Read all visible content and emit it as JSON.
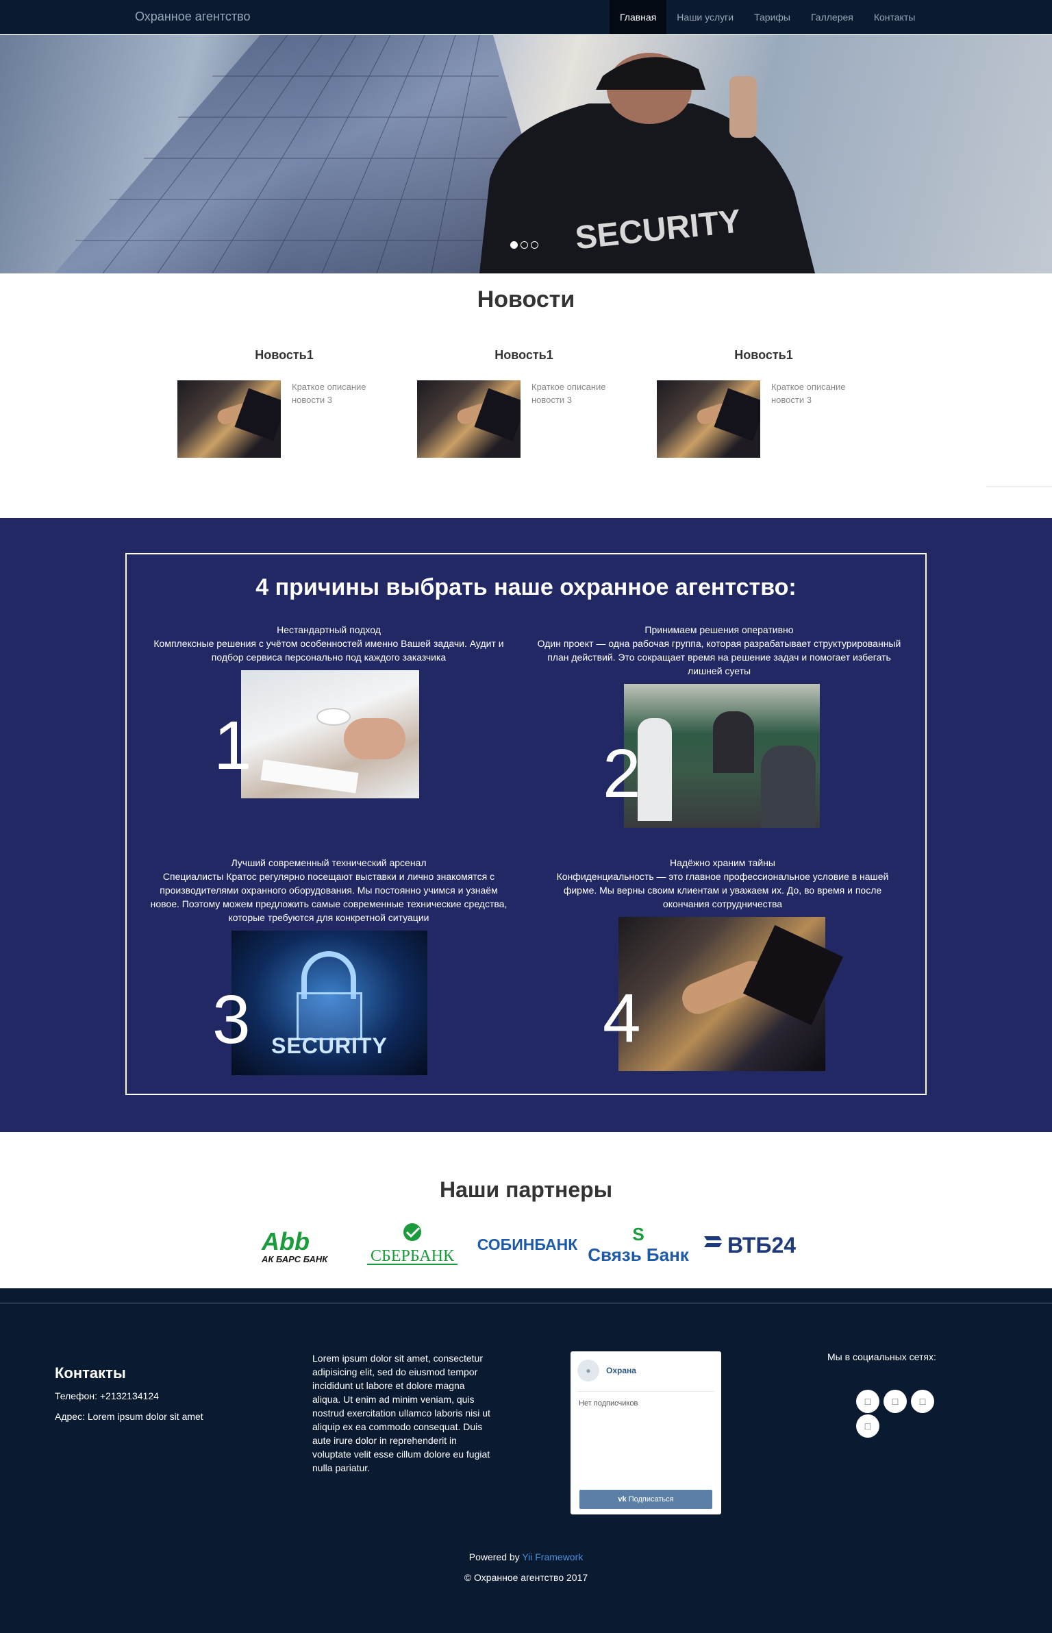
{
  "navbar": {
    "brand": "Охранное агентство",
    "items": [
      {
        "label": "Главная",
        "active": true
      },
      {
        "label": "Наши услуги"
      },
      {
        "label": "Тарифы"
      },
      {
        "label": "Галлерея"
      },
      {
        "label": "Контакты"
      }
    ]
  },
  "hero": {
    "caption": "SECURITY",
    "slides": 3,
    "active_slide": 1
  },
  "news": {
    "title": "Новости",
    "items": [
      {
        "title": "Новость1",
        "text": "Краткое описание новости 3"
      },
      {
        "title": "Новость1",
        "text": "Краткое описание новости 3"
      },
      {
        "title": "Новость1",
        "text": "Краткое описание новости 3"
      }
    ]
  },
  "reasons": {
    "title": "4 причины выбрать наше охранное агентство:",
    "items": [
      {
        "num": "1",
        "title": "Нестандартный подход",
        "text": "Комплексные решения с учётом особенностей именно Вашей задачи. Аудит и подбор сервиса персонально под каждого заказчика"
      },
      {
        "num": "2",
        "title": "Принимаем решения оперативно",
        "text": "Один проект — одна рабочая группа, которая разрабатывает структурированный план действий. Это сокращает время на решение задач и помогает избегать лишней суеты"
      },
      {
        "num": "3",
        "title": "Лучший современный технический арсенал",
        "text": "Специалисты Кратос регулярно посещают выставки и лично знакомятся с производителями охранного оборудования. Мы постоянно учимся и узнаём новое. Поэтому можем предложить самые современные технические средства, которые требуются для конкретной ситуации",
        "img_text": "SECURITY"
      },
      {
        "num": "4",
        "title": "Надёжно храним тайны",
        "text": "Конфиденциальность — это главное профессиональное условие в нашей фирме. Мы верны своим клиентам и уважаем их. До, во время и после окончания сотрудничества"
      }
    ]
  },
  "partners": {
    "title": "Наши партнеры",
    "logos": [
      {
        "name": "АК БАРС БАНК",
        "color": "#1a9b3c"
      },
      {
        "name": "СБЕРБАНК",
        "color": "#1a9b3c"
      },
      {
        "name": "СОБИНБАНК",
        "color": "#1e5aa8"
      },
      {
        "name": "Связь Банк",
        "color": "#1a9b3c",
        "name_color": "#1e5aa8"
      },
      {
        "name": "ВТБ24",
        "color": "#1e3a7a",
        "accent": "#d2232a"
      }
    ]
  },
  "footer": {
    "contacts_title": "Контакты",
    "phone": "Телефон: +2132134124",
    "address": "Адрес: Lorem ipsum dolor sit amet",
    "lorem": "Lorem ipsum dolor sit amet, consectetur adipisicing elit, sed do eiusmod tempor incididunt ut labore et dolore magna aliqua. Ut enim ad minim veniam, quis nostrud exercitation ullamco laboris nisi ut aliquip ex ea commodo consequat. Duis aute irure dolor in reprehenderit in voluptate velit esse cillum dolore eu fugiat nulla pariatur.",
    "vk_widget": {
      "group_name": "Охрана",
      "subscribers": "Нет подписчиков",
      "subscribe_label": "Подписаться"
    },
    "social_title": "Мы в социальных сетях:",
    "social_icons": [
      "social-icon",
      "social-icon",
      "social-icon",
      "social-icon"
    ],
    "powered_prefix": "Powered by ",
    "powered_link": "Yii Framework",
    "copyright": "© Охранное агентство 2017"
  },
  "colors": {
    "navbar": "#0a1a31",
    "reasons_bg": "#222864",
    "footer": "#0a1a31",
    "link": "#4a90d9"
  }
}
